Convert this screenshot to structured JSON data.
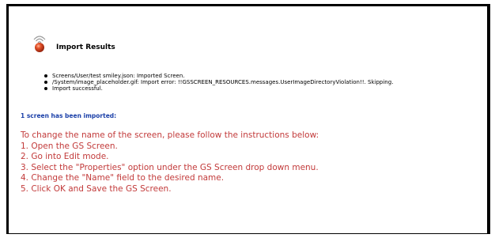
{
  "header": {
    "title": "Import Results",
    "icon": "gs-screen-icon"
  },
  "results": [
    "Screens/User/test smiley.json: Imported Screen.",
    "/System/image_placeholder.gif: Import error: !!GSSCREEN_RESOURCES.messages.UserImageDirectoryViolation!!. Skipping.",
    "Import successful."
  ],
  "summary": {
    "imported_count_text": "1 screen has been imported:"
  },
  "instructions": {
    "intro": "To change the name of the screen, please follow the instructions below:",
    "steps": [
      "1. Open the GS Screen.",
      "2. Go into Edit mode.",
      "3. Select the \"Properties\" option under the GS Screen drop down menu.",
      "4. Change the \"Name\" field to the desired name.",
      "5. Click OK and Save the GS Screen."
    ]
  },
  "colors": {
    "summary_text": "#1a3fa8",
    "instruction_text": "#c23a3a",
    "icon_ball": "#d4401c",
    "icon_waves": "#9a9a9a"
  }
}
